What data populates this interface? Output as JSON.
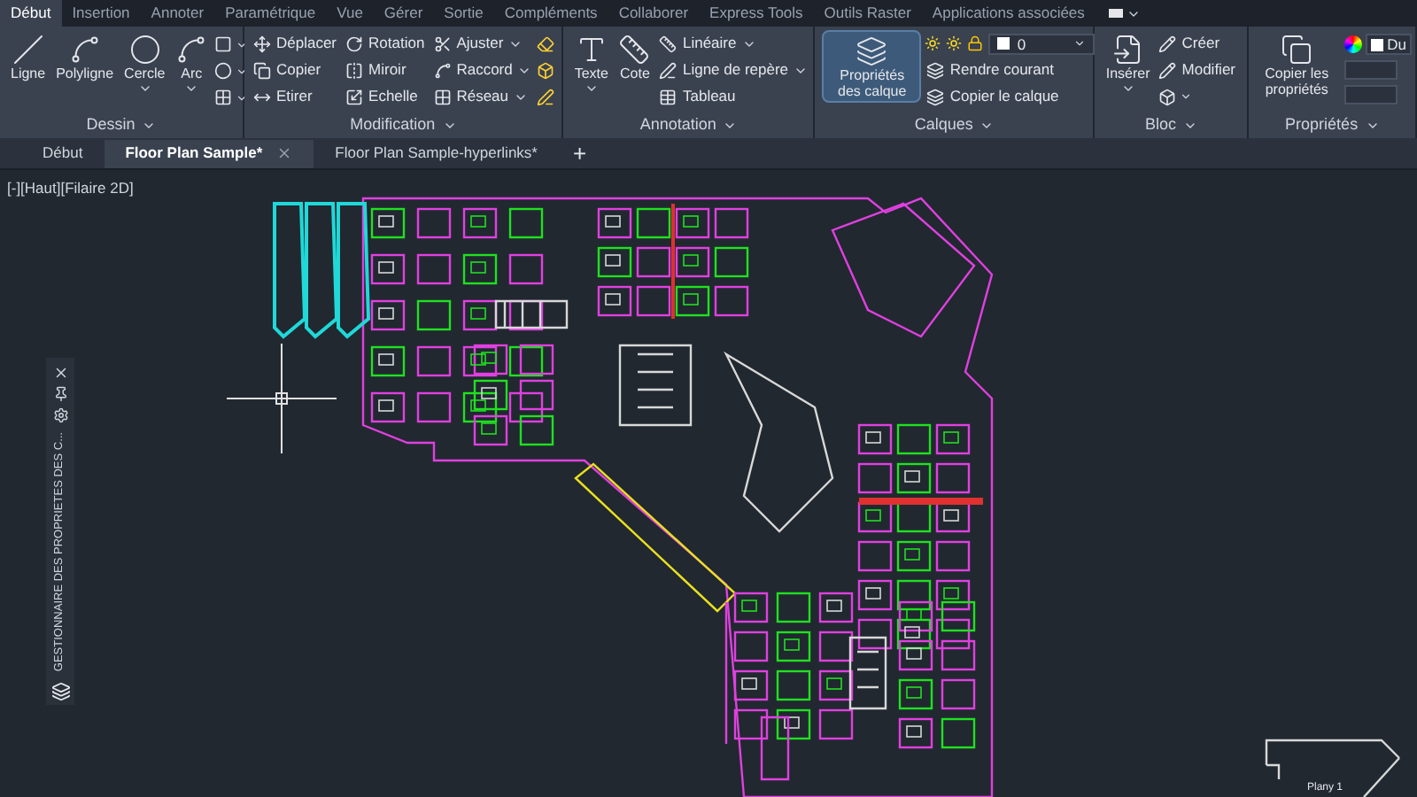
{
  "menu_tabs": [
    {
      "label": "Début",
      "selected": true
    },
    {
      "label": "Insertion",
      "selected": false
    },
    {
      "label": "Annoter",
      "selected": false
    },
    {
      "label": "Paramétrique",
      "selected": false
    },
    {
      "label": "Vue",
      "selected": false
    },
    {
      "label": "Gérer",
      "selected": false
    },
    {
      "label": "Sortie",
      "selected": false
    },
    {
      "label": "Compléments",
      "selected": false
    },
    {
      "label": "Collaborer",
      "selected": false
    },
    {
      "label": "Express Tools",
      "selected": false
    },
    {
      "label": "Outils Raster",
      "selected": false
    },
    {
      "label": "Applications associées",
      "selected": false
    }
  ],
  "panels": [
    {
      "title": "Dessin",
      "large": [
        {
          "label": "Ligne",
          "dropdown": false
        },
        {
          "label": "Polyligne",
          "dropdown": false
        },
        {
          "label": "Cercle",
          "dropdown": true
        },
        {
          "label": "Arc",
          "dropdown": true
        }
      ]
    },
    {
      "title": "Modification",
      "small": [
        {
          "label": "Déplacer",
          "dropdown": false
        },
        {
          "label": "Copier",
          "dropdown": false
        },
        {
          "label": "Etirer",
          "dropdown": false
        },
        {
          "label": "Rotation",
          "dropdown": false
        },
        {
          "label": "Miroir",
          "dropdown": false
        },
        {
          "label": "Echelle",
          "dropdown": false
        },
        {
          "label": "Ajuster",
          "dropdown": true
        },
        {
          "label": "Raccord",
          "dropdown": true
        },
        {
          "label": "Réseau",
          "dropdown": true
        }
      ]
    },
    {
      "title": "Annotation",
      "large": [
        {
          "label": "Texte",
          "dropdown": true
        },
        {
          "label": "Cote",
          "dropdown": false
        }
      ],
      "small": [
        {
          "label": "Linéaire",
          "dropdown": true
        },
        {
          "label": "Ligne de repère",
          "dropdown": true
        },
        {
          "label": "Tableau",
          "dropdown": false
        }
      ]
    },
    {
      "title": "Calques",
      "large": [
        {
          "label": "Propriétés des calque",
          "dropdown": false
        }
      ],
      "layer_value": "0",
      "small": [
        {
          "label": "Rendre courant",
          "dropdown": false
        },
        {
          "label": "Copier le calque",
          "dropdown": false
        }
      ]
    },
    {
      "title": "Bloc",
      "large": [
        {
          "label": "Insérer",
          "dropdown": true
        }
      ],
      "small": [
        {
          "label": "Créer",
          "dropdown": false
        },
        {
          "label": "Modifier",
          "dropdown": false
        }
      ]
    },
    {
      "title": "Propriétés",
      "large": [
        {
          "label": "Copier les propriétés",
          "dropdown": false
        }
      ],
      "color_value": "Du"
    }
  ],
  "file_tabs": [
    {
      "label": "Début",
      "selected": false,
      "closable": false
    },
    {
      "label": "Floor Plan Sample*",
      "selected": true,
      "closable": true
    },
    {
      "label": "Floor Plan Sample-hyperlinks*",
      "selected": false,
      "closable": false
    }
  ],
  "new_tab": "+",
  "viewport_label": "[-][Haut][Filaire 2D]",
  "palette": {
    "title": "GESTIONNAIRE DES PROPRIETES DES C..."
  },
  "drawing_label": "Plany 1"
}
